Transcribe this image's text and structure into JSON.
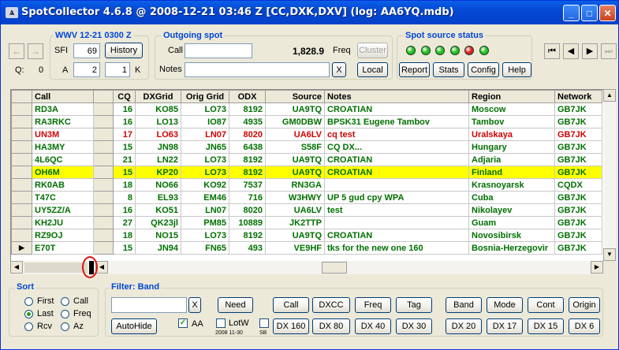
{
  "window": {
    "title": "SpotCollector 4.6.8 @ 2008-12-21  03:46 Z [CC,DXK,DXV] (log: AA6YQ.mdb)",
    "app_icon": "antenna-icon"
  },
  "nav": {
    "back": "←",
    "forward": "→",
    "q_label": "Q:",
    "q_value": "0"
  },
  "wwv": {
    "title": "WWV 12-21 0300 Z",
    "sfi_label": "SFI",
    "sfi_value": "69",
    "history": "History",
    "a_label": "A",
    "a_value": "2",
    "k_value": "1",
    "k_label": "K"
  },
  "outgoing": {
    "title": "Outgoing spot",
    "call_label": "Call",
    "call_value": "",
    "freq_value": "1,828.9",
    "freq_label": "Freq",
    "cluster": "Cluster",
    "notes_label": "Notes",
    "notes_value": "",
    "clear": "X",
    "local": "Local"
  },
  "source_status": {
    "title": "Spot source status",
    "leds": [
      "#22c222",
      "#22c222",
      "#22c222",
      "#22c222",
      "#e02020",
      "#22c222"
    ],
    "report": "Report",
    "stats": "Stats",
    "config": "Config",
    "help": "Help"
  },
  "playback": {
    "first": "⏮",
    "prev": "◀",
    "next": "▶",
    "last": "⏭"
  },
  "grid": {
    "columns": [
      "Call",
      "CQ",
      "DXGrid",
      "Orig Grid",
      "ODX",
      "Source",
      "Notes",
      "Region",
      "Network"
    ],
    "rows": [
      {
        "call": "RD3A",
        "cq": "16",
        "dxgrid": "KO85",
        "orig": "LO73",
        "odx": "8192",
        "source": "UA9TQ",
        "notes": "CROATIAN",
        "region": "Moscow",
        "network": "GB7JK",
        "color": "#007000",
        "bg": "#ffffff",
        "marker": ""
      },
      {
        "call": "RA3RKC",
        "cq": "16",
        "dxgrid": "LO13",
        "orig": "IO87",
        "odx": "4935",
        "source": "GM0DBW",
        "notes": "BPSK31 Eugene Tambov",
        "region": "Tambov",
        "network": "GB7JK",
        "color": "#007000",
        "bg": "#ffffff",
        "marker": ""
      },
      {
        "call": "UN3M",
        "cq": "17",
        "dxgrid": "LO63",
        "orig": "LN07",
        "odx": "8020",
        "source": "UA6LV",
        "notes": "cq test",
        "region": "Uralskaya",
        "network": "GB7JK",
        "color": "#d00000",
        "bg": "#ffffff",
        "marker": ""
      },
      {
        "call": "HA3MY",
        "cq": "15",
        "dxgrid": "JN98",
        "orig": "JN65",
        "odx": "6438",
        "source": "S58F",
        "notes": "CQ DX...",
        "region": "Hungary",
        "network": "GB7JK",
        "color": "#007000",
        "bg": "#ffffff",
        "marker": ""
      },
      {
        "call": "4L6QC",
        "cq": "21",
        "dxgrid": "LN22",
        "orig": "LO73",
        "odx": "8192",
        "source": "UA9TQ",
        "notes": "CROATIAN",
        "region": "Adjaria",
        "network": "GB7JK",
        "color": "#007000",
        "bg": "#ffffff",
        "marker": ""
      },
      {
        "call": "OH6M",
        "cq": "15",
        "dxgrid": "KP20",
        "orig": "LO73",
        "odx": "8192",
        "source": "UA9TQ",
        "notes": "CROATIAN",
        "region": "Finland",
        "network": "GB7JK",
        "color": "#007000",
        "bg": "#ffff00",
        "marker": ""
      },
      {
        "call": "RK0AB",
        "cq": "18",
        "dxgrid": "NO66",
        "orig": "KO92",
        "odx": "7537",
        "source": "RN3GA",
        "notes": "",
        "region": "Krasnoyarsk",
        "network": "CQDX",
        "color": "#007000",
        "bg": "#ffffff",
        "marker": ""
      },
      {
        "call": "T47C",
        "cq": "8",
        "dxgrid": "EL93",
        "orig": "EM46",
        "odx": "716",
        "source": "W3HWY",
        "notes": "UP 5 gud cpy WPA",
        "region": "Cuba",
        "network": "GB7JK",
        "color": "#007000",
        "bg": "#ffffff",
        "marker": ""
      },
      {
        "call": "UY5ZZ/A",
        "cq": "16",
        "dxgrid": "KO51",
        "orig": "LN07",
        "odx": "8020",
        "source": "UA6LV",
        "notes": "test",
        "region": "Nikolayev",
        "network": "GB7JK",
        "color": "#007000",
        "bg": "#ffffff",
        "marker": ""
      },
      {
        "call": "KH2JU",
        "cq": "27",
        "dxgrid": "QK23jl",
        "orig": "PM85",
        "odx": "10889",
        "source": "JK2TTP",
        "notes": "",
        "region": "Guam",
        "network": "GB7JK",
        "color": "#007000",
        "bg": "#ffffff",
        "marker": ""
      },
      {
        "call": "RZ9OJ",
        "cq": "18",
        "dxgrid": "NO15",
        "orig": "LO73",
        "odx": "8192",
        "source": "UA9TQ",
        "notes": "CROATIAN",
        "region": "Novosibirsk",
        "network": "GB7JK",
        "color": "#007000",
        "bg": "#ffffff",
        "marker": ""
      },
      {
        "call": "E70T",
        "cq": "15",
        "dxgrid": "JN94",
        "orig": "FN65",
        "odx": "493",
        "source": "VE9HF",
        "notes": "tks for the new one 160",
        "region": "Bosnia-Herzegovir",
        "network": "GB7JK",
        "color": "#007000",
        "bg": "#ffffff",
        "marker": "▶"
      }
    ]
  },
  "sort": {
    "title": "Sort",
    "options": [
      {
        "label": "First",
        "checked": false
      },
      {
        "label": "Call",
        "checked": false
      },
      {
        "label": "Last",
        "checked": true
      },
      {
        "label": "Freq",
        "checked": false
      },
      {
        "label": "Rcv",
        "checked": false
      },
      {
        "label": "Az",
        "checked": false
      }
    ]
  },
  "filter": {
    "title": "Filter: Band",
    "input_value": "",
    "clear": "X",
    "need": "Need",
    "row1": [
      "Call",
      "DXCC",
      "Freq",
      "Tag",
      "Band",
      "Mode",
      "Cont",
      "Origin"
    ],
    "autohide": "AutoHide",
    "aa_label": "AA",
    "lotw_label": "LotW",
    "lotw_date": "2008 11-30",
    "sb_label": "SB",
    "row2": [
      "DX 160",
      "DX 80",
      "DX 40",
      "DX 30",
      "DX 20",
      "DX 17",
      "DX 15",
      "DX 6"
    ]
  }
}
